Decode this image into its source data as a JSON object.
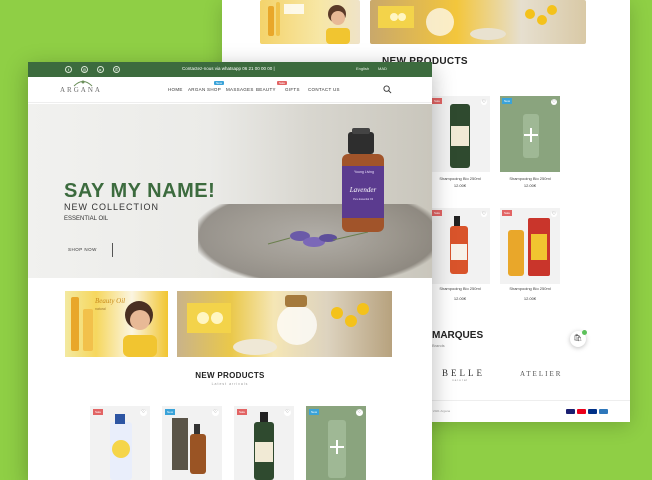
{
  "back_page": {
    "section_title": "NEW PRODUCTS",
    "products": [
      {
        "badge": "Sale",
        "name": "Shampooing Bio 250ml",
        "price": "12.00€"
      },
      {
        "badge": "New",
        "name": "Shampooing Bio 250ml",
        "price": "12.00€"
      },
      {
        "badge": "Sale",
        "name": "Shampooing Bio 250ml",
        "price": "12.00€"
      },
      {
        "badge": "Sale",
        "name": "Shampooing Bio 250ml",
        "price": "12.00€"
      }
    ],
    "brands_title": "MARQUES",
    "brands_sub": "Brands",
    "brand1": "BELLE",
    "brand1_sub": "natural",
    "brand2": "ATELIER",
    "copyright": "© 2021 Argana",
    "payments": [
      "visa",
      "mastercard",
      "paypal",
      "amex"
    ]
  },
  "front_page": {
    "social_icons": [
      "facebook-icon",
      "instagram-icon",
      "youtube-icon",
      "whatsapp-icon"
    ],
    "contact_text": "Contactez-nous via whatsapp 06 21 00 00 00 |",
    "language": "English",
    "currency": "MAD",
    "logo": "ARGANA",
    "nav": [
      {
        "label": "HOME"
      },
      {
        "label": "ARGAN SHOP",
        "badge": "New",
        "badge_color": "#3aa3d9"
      },
      {
        "label": "MASSAGES"
      },
      {
        "label": "BEAUTY",
        "badge": "Sale",
        "badge_color": "#e26464"
      },
      {
        "label": "GIFTS"
      },
      {
        "label": "CONTACT US"
      }
    ],
    "hero": {
      "headline": "SAY MY NAME!",
      "subheadline": "NEW COLLECTION",
      "tagline": "ESSENTIAL OIL",
      "button": "SHOP NOW",
      "bottle_brand": "Young Living",
      "bottle_label": "Lavender",
      "bottle_sub": "Pure Essential Oil"
    },
    "promo1_text": "Beauty Oil",
    "promo1_sub": "natural",
    "section_title": "NEW PRODUCTS",
    "section_sub": "Latest arrivals",
    "products": [
      {
        "badge": "Sale"
      },
      {
        "badge": "New"
      },
      {
        "badge": "Sale"
      },
      {
        "badge": "New"
      }
    ]
  },
  "colors": {
    "background": "#8fcf45",
    "brand_green": "#3c6b3e",
    "sale": "#e26464",
    "new": "#3aa3d9"
  }
}
